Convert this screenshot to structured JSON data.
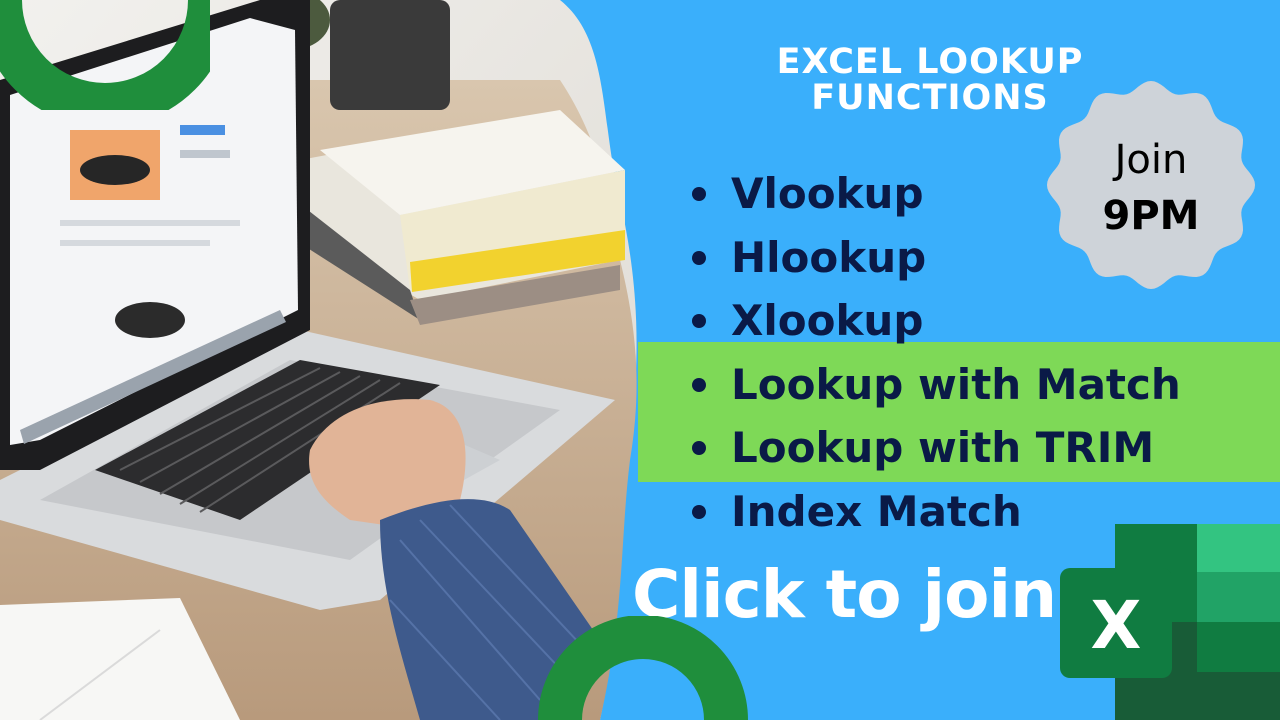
{
  "title": {
    "line1": "EXCEL LOOKUP",
    "line2": "FUNCTIONS"
  },
  "items": [
    {
      "label": "Vlookup"
    },
    {
      "label": "Hlookup"
    },
    {
      "label": "Xlookup"
    },
    {
      "label": "Lookup with Match"
    },
    {
      "label": "Lookup with TRIM"
    },
    {
      "label": "Index Match"
    }
  ],
  "badge": {
    "line1": "Join",
    "line2": "9PM"
  },
  "cta": {
    "label": "Click to join"
  },
  "excel_logo": {
    "letter": "X"
  },
  "colors": {
    "background": "#3AAFFB",
    "highlight_band": "#7ED957",
    "text_dark": "#0A1A47",
    "badge": "#CED3D9",
    "arc_green": "#1F8E3C",
    "excel_green": "#107C41"
  }
}
